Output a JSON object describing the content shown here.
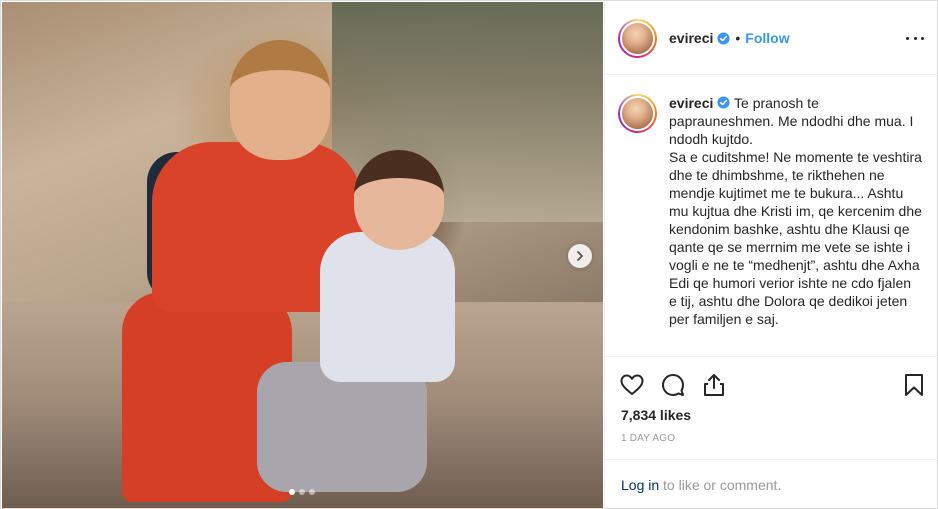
{
  "post": {
    "username": "evireci",
    "follow_label": "Follow",
    "bullet": "•",
    "caption": {
      "username": "evireci",
      "lines": [
        "Te pranosh te paprauneshmen. Me ndodhi dhe mua. I ndodh kujtdo.",
        "Sa e cuditshme! Ne momente te veshtira dhe te dhimbshme, te rikthehen ne mendje kujtimet me te bukura... Ashtu mu kujtua dhe Kristi im, qe kercenim dhe kendonim bashke, ashtu dhe Klausi qe qante qe se merrnim me vete se ishte i vogli e ne te “medhenjt”, ashtu dhe Axha Edi qe humori verior ishte ne cdo fjalen e tij, ashtu dhe Dolora qe dedikoi jeten per familjen e saj."
      ]
    },
    "likes": "7,834 likes",
    "time": "1 DAY AGO",
    "login_link": "Log in",
    "login_suffix": " to like or comment.",
    "carousel": {
      "total_slides": 3,
      "active_slide": 1
    }
  },
  "colors": {
    "accent": "#3897f0",
    "link_dark": "#003569",
    "muted": "#999999",
    "text": "#262626"
  },
  "icons": {
    "verified": "verified-badge-icon",
    "more": "more-options-icon",
    "next": "chevron-right-icon",
    "like": "heart-icon",
    "comment": "comment-icon",
    "share": "share-icon",
    "save": "bookmark-icon"
  }
}
